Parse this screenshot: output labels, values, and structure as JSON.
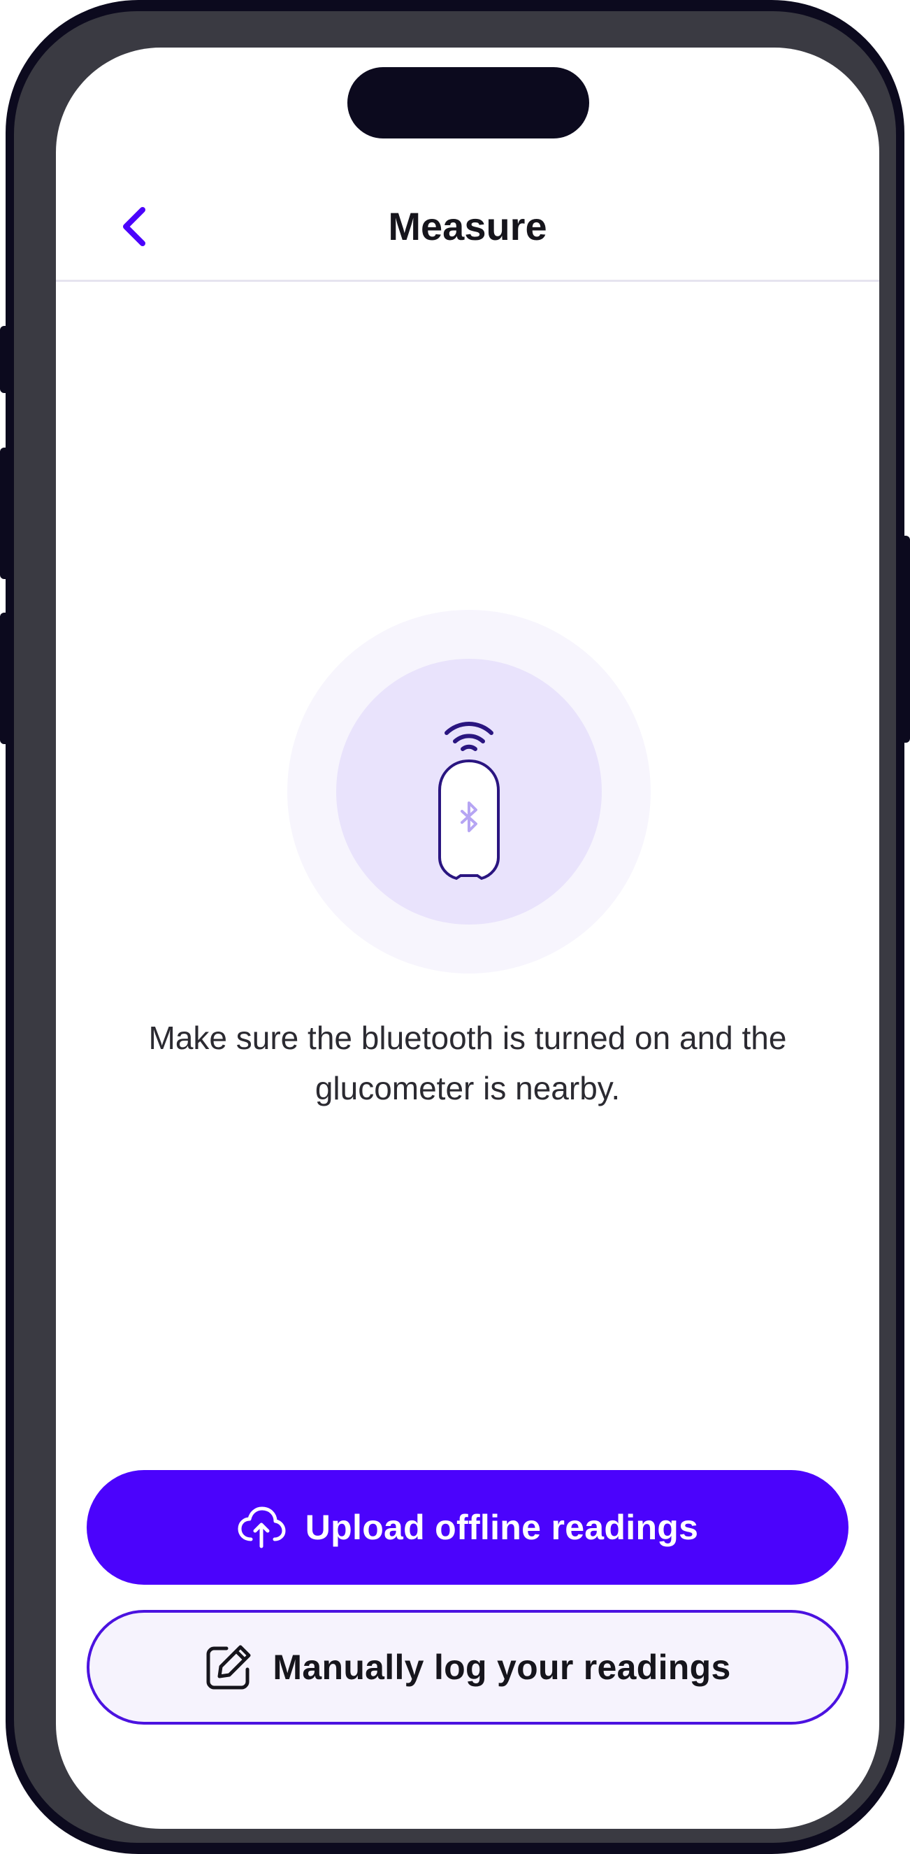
{
  "header": {
    "title": "Measure",
    "back_icon": "chevron-left-icon"
  },
  "illustration": {
    "device_icon": "glucometer-icon",
    "signal_icon": "wifi-signal-icon",
    "bluetooth_icon": "bluetooth-icon"
  },
  "instructions": {
    "text": "Make sure the bluetooth is turned on and the glucometer is nearby."
  },
  "actions": {
    "upload_label": "Upload offline readings",
    "upload_icon": "cloud-upload-icon",
    "manual_label": "Manually log your readings",
    "manual_icon": "edit-icon"
  },
  "colors": {
    "accent": "#4b03fc",
    "accent_border": "#4b12e0",
    "halo_outer": "#f7f5fd",
    "halo_inner": "#e9e3fc",
    "device_stroke": "#2a1580",
    "bluetooth_glyph": "#b6a5f3",
    "text_dark": "#16151c"
  }
}
